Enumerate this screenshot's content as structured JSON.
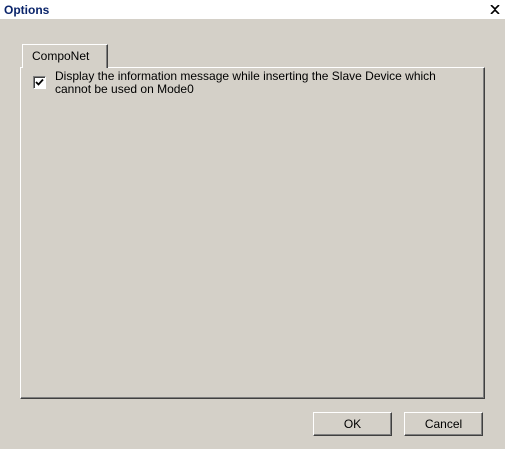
{
  "window": {
    "title": "Options",
    "close_icon": "close-icon"
  },
  "tabs": [
    {
      "label": "CompoNet",
      "selected": true
    }
  ],
  "options": {
    "show_mode0_message": {
      "checked": true,
      "label": "Display the information message while inserting the Slave Device which cannot be used on Mode0"
    }
  },
  "buttons": {
    "ok_label": "OK",
    "cancel_label": "Cancel"
  },
  "colors": {
    "dialog_bg": "#d4d0c8",
    "title_text": "#0a246a"
  }
}
